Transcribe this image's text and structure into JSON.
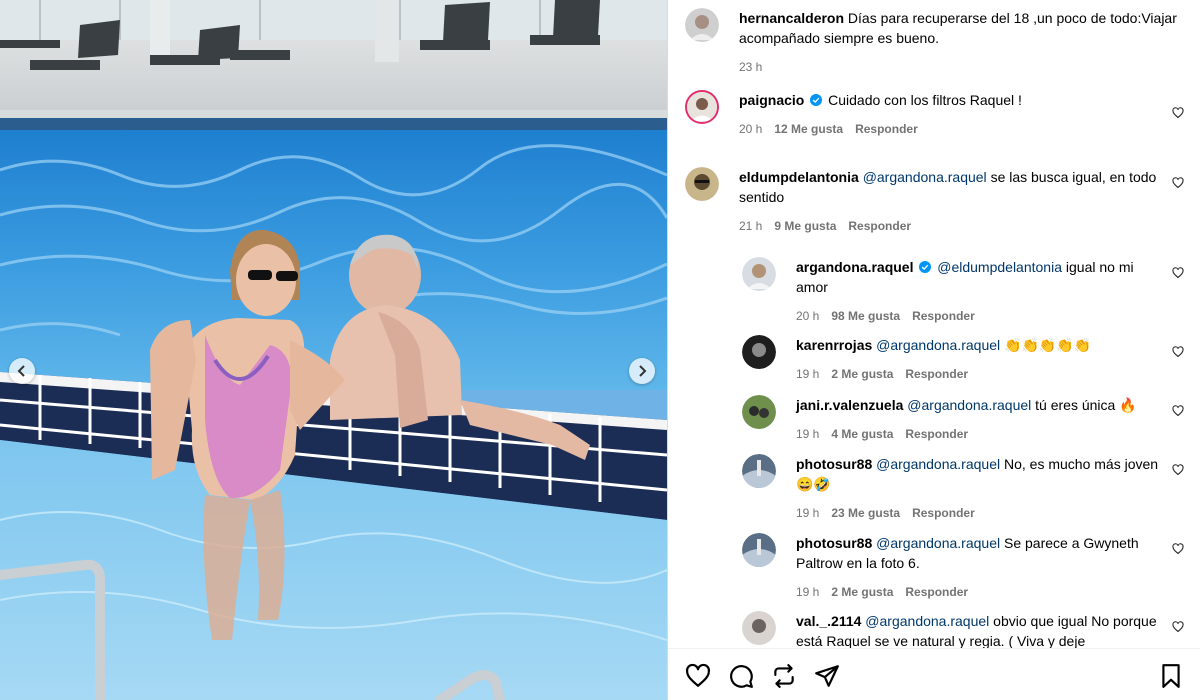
{
  "caption": {
    "username": "hernancalderon",
    "text": "Días para recuperarse del 18 ,un poco de todo:Viajar acompañado siempre es bueno.",
    "time": "23 h"
  },
  "comments": [
    {
      "username": "paignacio",
      "verified": true,
      "mention": "",
      "text": "Cuidado con los filtros Raquel !",
      "time": "20 h",
      "likes": "12 Me gusta",
      "reply": "Responder"
    },
    {
      "username": "eldumpdelantonia",
      "verified": false,
      "mention": "@argandona.raquel",
      "text": "se las busca igual, en todo sentido",
      "time": "21 h",
      "likes": "9 Me gusta",
      "reply": "Responder"
    },
    {
      "username": "argandona.raquel",
      "verified": true,
      "mention": "@eldumpdelantonia",
      "text": "igual no mi amor",
      "time": "20 h",
      "likes": "98 Me gusta",
      "reply": "Responder"
    },
    {
      "username": "karenrrojas",
      "verified": false,
      "mention": "@argandona.raquel",
      "text": "👏👏👏👏👏",
      "time": "19 h",
      "likes": "2 Me gusta",
      "reply": "Responder"
    },
    {
      "username": "jani.r.valenzuela",
      "verified": false,
      "mention": "@argandona.raquel",
      "text": "tú eres única 🔥",
      "time": "19 h",
      "likes": "4 Me gusta",
      "reply": "Responder"
    },
    {
      "username": "photosur88",
      "verified": false,
      "mention": "@argandona.raquel",
      "text": "No, es mucho más joven 😄🤣",
      "time": "19 h",
      "likes": "23 Me gusta",
      "reply": "Responder"
    },
    {
      "username": "photosur88",
      "verified": false,
      "mention": "@argandona.raquel",
      "text": "Se parece a Gwyneth Paltrow en la foto 6.",
      "time": "19 h",
      "likes": "2 Me gusta",
      "reply": "Responder"
    },
    {
      "username": "val._.2114",
      "verified": false,
      "mention": "@argandona.raquel",
      "text": "obvio que igual No porque está Raquel se ve natural y regia. ( Viva y deje",
      "time": "",
      "likes": "",
      "reply": ""
    }
  ],
  "icons": {
    "like": "heart-icon",
    "comment": "comment-icon",
    "share": "repost-icon",
    "send": "send-icon",
    "save": "bookmark-icon"
  },
  "colors": {
    "mention": "#00376b",
    "meta": "#737373",
    "verified": "#0095f6"
  }
}
